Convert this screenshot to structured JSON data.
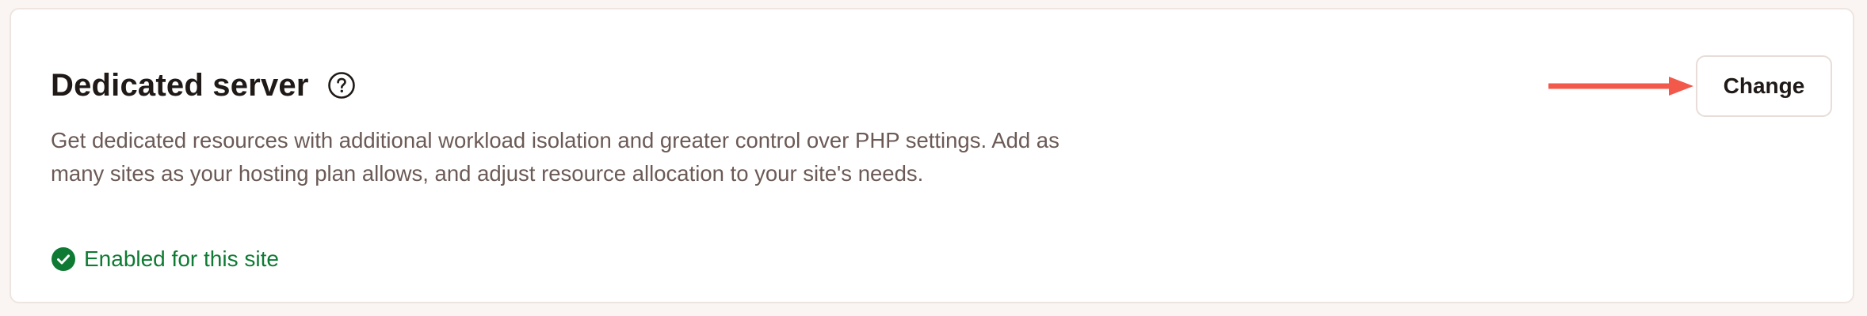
{
  "section": {
    "title": "Dedicated server",
    "description": "Get dedicated resources with additional workload isolation and greater control over PHP settings. Add as many sites as your hosting plan allows, and adjust resource allocation to your site's needs.",
    "status_text": "Enabled for this site",
    "change_label": "Change"
  },
  "icons": {
    "help": "question-circle-icon",
    "status": "check-circle-icon",
    "pointer": "arrow-right-icon"
  },
  "colors": {
    "status_green": "#0e7a33",
    "arrow": "#f2594b",
    "description": "#6b5a55",
    "title": "#1f1a17"
  }
}
